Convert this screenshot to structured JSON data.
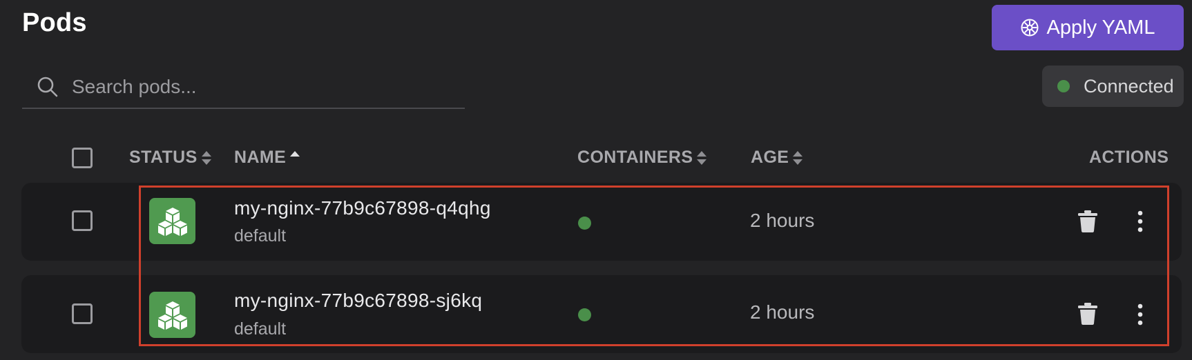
{
  "header": {
    "title": "Pods",
    "apply_button": {
      "label": "Apply YAML",
      "icon": "kubernetes-helm-icon",
      "color": "#6b4fc7"
    }
  },
  "search": {
    "placeholder": "Search pods...",
    "value": ""
  },
  "connection": {
    "label": "Connected",
    "status_color": "#4a8f4a"
  },
  "table": {
    "columns": [
      {
        "key": "status",
        "label": "STATUS",
        "sort": "none"
      },
      {
        "key": "name",
        "label": "NAME",
        "sort": "asc"
      },
      {
        "key": "containers",
        "label": "CONTAINERS",
        "sort": "none"
      },
      {
        "key": "age",
        "label": "AGE",
        "sort": "none"
      },
      {
        "key": "actions",
        "label": "ACTIONS"
      }
    ],
    "rows": [
      {
        "name": "my-nginx-77b9c67898-q4qhg",
        "namespace": "default",
        "age": "2 hours",
        "status_color": "#509a50",
        "container_status_color": "#4a8f4a"
      },
      {
        "name": "my-nginx-77b9c67898-sj6kq",
        "namespace": "default",
        "age": "2 hours",
        "status_color": "#509a50",
        "container_status_color": "#4a8f4a"
      }
    ]
  },
  "colors": {
    "background": "#232325",
    "row_background": "#1b1b1d",
    "highlight": "#d0402c"
  }
}
